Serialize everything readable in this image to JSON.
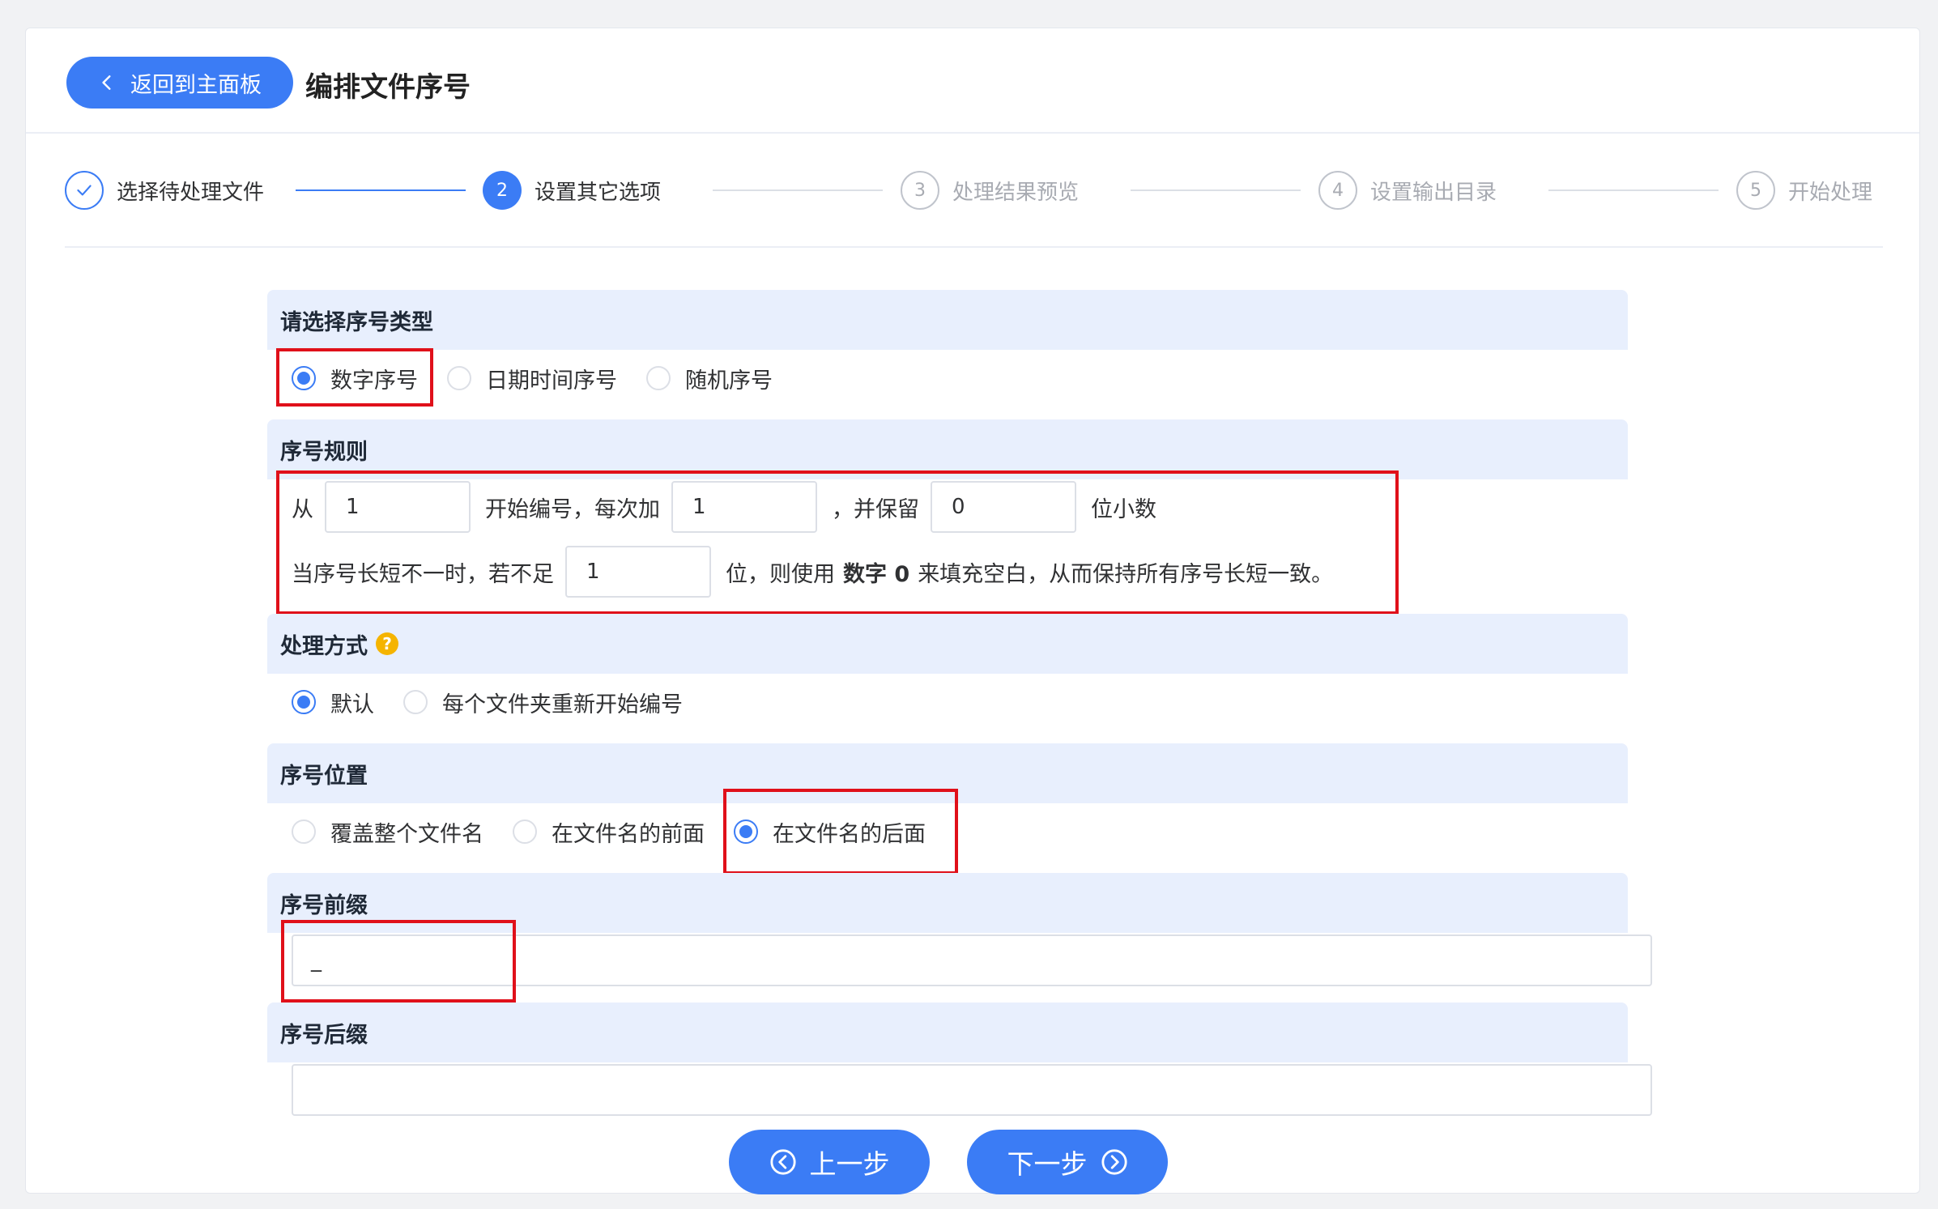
{
  "header": {
    "back_label": "返回到主面板",
    "title": "编排文件序号"
  },
  "steps": [
    {
      "num": "1",
      "label": "选择待处理文件",
      "state": "done"
    },
    {
      "num": "2",
      "label": "设置其它选项",
      "state": "active"
    },
    {
      "num": "3",
      "label": "处理结果预览",
      "state": "todo"
    },
    {
      "num": "4",
      "label": "设置输出目录",
      "state": "todo"
    },
    {
      "num": "5",
      "label": "开始处理",
      "state": "todo"
    }
  ],
  "serial_type": {
    "title": "请选择序号类型",
    "options": [
      "数字序号",
      "日期时间序号",
      "随机序号"
    ],
    "selected": "数字序号"
  },
  "serial_rule": {
    "title": "序号规则",
    "from_label": "从",
    "start_value": "1",
    "step_label": "开始编号，每次加",
    "step_value": "1",
    "keep_label": "，并保留",
    "decimals_value": "0",
    "decimals_label": "位小数",
    "pad_label_pre": "当序号长短不一时，若不足",
    "pad_value": "1",
    "pad_label_mid": "位，则使用",
    "pad_char_label": "数字 0",
    "pad_label_post": "来填充空白，从而保持所有序号长短一致。"
  },
  "process_mode": {
    "title": "处理方式",
    "options": [
      "默认",
      "每个文件夹重新开始编号"
    ],
    "selected": "默认"
  },
  "serial_position": {
    "title": "序号位置",
    "options": [
      "覆盖整个文件名",
      "在文件名的前面",
      "在文件名的后面"
    ],
    "selected": "在文件名的后面"
  },
  "prefix": {
    "title": "序号前缀",
    "value": "_"
  },
  "suffix": {
    "title": "序号后缀",
    "value": ""
  },
  "nav": {
    "prev_label": "上一步",
    "next_label": "下一步"
  },
  "colors": {
    "accent": "#3b7cf5",
    "section_bg": "#e8effd",
    "highlight": "#e0101a",
    "help": "#f5b400"
  }
}
